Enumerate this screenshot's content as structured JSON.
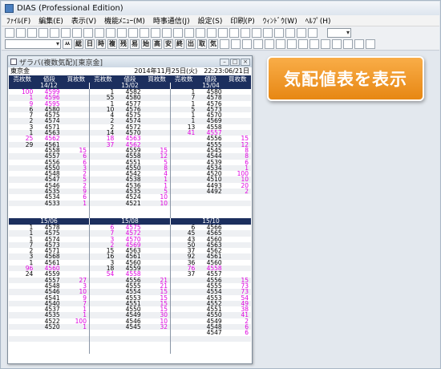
{
  "app": {
    "title": "DIAS (Professional Edition)"
  },
  "menu": [
    "ﾌｧｲﾙ(F)",
    "編集(E)",
    "表示(V)",
    "機能ﾒﾆｭｰ(M)",
    "時事通信(J)",
    "設定(S)",
    "印刷(P)",
    "ｳｨﾝﾄﾞｳ(W)",
    "ﾍﾙﾌﾟ(H)"
  ],
  "toolbar2_kanji": [
    "始",
    "高",
    "安",
    "終",
    "出",
    "取",
    "気"
  ],
  "toolbar2_glyph": [
    "ㅆ",
    "総",
    "日",
    "時",
    "複",
    "残",
    "易"
  ],
  "window": {
    "title": "ザラバ(複数気配)[東京金]",
    "symbol": "東京金",
    "datetime": "2014年11月25日(火)　22:23:06/21日"
  },
  "cols": [
    "売枚数",
    "値段",
    "買枚数"
  ],
  "top_months": [
    "14/12",
    "15/02",
    "15/04"
  ],
  "bottom_months": [
    "15/06",
    "15/08",
    "15/10"
  ],
  "top": [
    [
      [
        "100",
        "4599",
        ""
      ],
      [
        "1",
        "4596",
        ""
      ],
      [
        "9",
        "4595",
        ""
      ],
      [
        "6",
        "4580",
        ""
      ],
      [
        "7",
        "4575",
        ""
      ],
      [
        "2",
        "4574",
        ""
      ],
      [
        "3",
        "4571",
        ""
      ],
      [
        "1",
        "4563",
        ""
      ],
      [
        "25",
        "4562",
        ""
      ],
      [
        "29",
        "4561",
        ""
      ],
      [
        "",
        "4558",
        "15"
      ],
      [
        "",
        "4557",
        "6"
      ],
      [
        "",
        "4556",
        "6"
      ],
      [
        "",
        "4550",
        "3"
      ],
      [
        "",
        "4548",
        "2"
      ],
      [
        "",
        "4547",
        "5"
      ],
      [
        "",
        "4546",
        "2"
      ],
      [
        "",
        "4535",
        "9"
      ],
      [
        "",
        "4534",
        "6"
      ],
      [
        "",
        "4533",
        "1"
      ]
    ],
    [
      [
        "1",
        "4582",
        ""
      ],
      [
        "55",
        "4580",
        ""
      ],
      [
        "1",
        "4577",
        ""
      ],
      [
        "10",
        "4576",
        ""
      ],
      [
        "4",
        "4575",
        ""
      ],
      [
        "2",
        "4574",
        ""
      ],
      [
        "2",
        "4572",
        ""
      ],
      [
        "14",
        "4570",
        ""
      ],
      [
        "18",
        "4563",
        ""
      ],
      [
        "37",
        "4562",
        ""
      ],
      [
        "",
        "4559",
        "15"
      ],
      [
        "",
        "4558",
        "12"
      ],
      [
        "",
        "4551",
        "5"
      ],
      [
        "",
        "4550",
        "8"
      ],
      [
        "",
        "4542",
        "4"
      ],
      [
        "",
        "4538",
        "1"
      ],
      [
        "",
        "4536",
        "1"
      ],
      [
        "",
        "4535",
        "5"
      ],
      [
        "",
        "4524",
        "10"
      ],
      [
        "",
        "4521",
        "10"
      ]
    ],
    [
      [
        "1",
        "4580",
        ""
      ],
      [
        "7",
        "4578",
        ""
      ],
      [
        "1",
        "4576",
        ""
      ],
      [
        "5",
        "4573",
        ""
      ],
      [
        "1",
        "4570",
        ""
      ],
      [
        "1",
        "4569",
        ""
      ],
      [
        "13",
        "4558",
        ""
      ],
      [
        "41",
        "4557",
        ""
      ],
      [
        "",
        "4556",
        "15"
      ],
      [
        "",
        "4555",
        "12"
      ],
      [
        "",
        "4545",
        "8"
      ],
      [
        "",
        "4544",
        "8"
      ],
      [
        "",
        "4539",
        "6"
      ],
      [
        "",
        "4534",
        "1"
      ],
      [
        "",
        "4520",
        "100"
      ],
      [
        "",
        "4510",
        "10"
      ],
      [
        "",
        "4493",
        "20"
      ],
      [
        "",
        "4492",
        "2"
      ],
      [
        "",
        "",
        ""
      ],
      [
        "",
        "",
        ""
      ]
    ]
  ],
  "bottom": [
    [
      [
        "1",
        "4578",
        ""
      ],
      [
        "1",
        "4575",
        ""
      ],
      [
        "1",
        "4574",
        ""
      ],
      [
        "7",
        "4573",
        ""
      ],
      [
        "2",
        "4571",
        ""
      ],
      [
        "3",
        "4568",
        ""
      ],
      [
        "1",
        "4561",
        ""
      ],
      [
        "96",
        "4560",
        ""
      ],
      [
        "24",
        "4559",
        ""
      ],
      [
        "",
        "4557",
        "27"
      ],
      [
        "",
        "4548",
        "3"
      ],
      [
        "",
        "4546",
        "10"
      ],
      [
        "",
        "4541",
        "9"
      ],
      [
        "",
        "4540",
        "7"
      ],
      [
        "",
        "4537",
        "1"
      ],
      [
        "",
        "4535",
        "1"
      ],
      [
        "",
        "4522",
        "100"
      ],
      [
        "",
        "4520",
        "1"
      ],
      [
        "",
        "",
        " "
      ],
      [
        "",
        "",
        ""
      ]
    ],
    [
      [
        "6",
        "4575",
        ""
      ],
      [
        "7",
        "4572",
        ""
      ],
      [
        "3",
        "4570",
        ""
      ],
      [
        "2",
        "4569",
        ""
      ],
      [
        "15",
        "4563",
        ""
      ],
      [
        "16",
        "4561",
        ""
      ],
      [
        "3",
        "4560",
        ""
      ],
      [
        "18",
        "4559",
        ""
      ],
      [
        "54",
        "4558",
        ""
      ],
      [
        "",
        "4556",
        "21"
      ],
      [
        "",
        "4555",
        "21"
      ],
      [
        "",
        "4554",
        "15"
      ],
      [
        "",
        "4553",
        "15"
      ],
      [
        "",
        "4551",
        "15"
      ],
      [
        "",
        "4550",
        "15"
      ],
      [
        "",
        "4549",
        "30"
      ],
      [
        "",
        "4546",
        "10"
      ],
      [
        "",
        "4545",
        "32"
      ],
      [
        "",
        "",
        ""
      ],
      [
        "",
        "",
        ""
      ]
    ],
    [
      [
        "6",
        "4566",
        ""
      ],
      [
        "45",
        "4565",
        ""
      ],
      [
        "43",
        "4560",
        ""
      ],
      [
        "50",
        "4563",
        ""
      ],
      [
        "37",
        "4562",
        ""
      ],
      [
        "92",
        "4561",
        ""
      ],
      [
        "36",
        "4560",
        ""
      ],
      [
        "76",
        "4558",
        ""
      ],
      [
        "37",
        "4557",
        ""
      ],
      [
        "",
        "4556",
        "15"
      ],
      [
        "",
        "4555",
        "73"
      ],
      [
        "",
        "4554",
        "73"
      ],
      [
        "",
        "4553",
        "54"
      ],
      [
        "",
        "4552",
        "49"
      ],
      [
        "",
        "4551",
        "38"
      ],
      [
        "",
        "4550",
        "41"
      ],
      [
        "",
        "4549",
        "2"
      ],
      [
        "",
        "4548",
        "6"
      ],
      [
        "",
        "4547",
        "6"
      ],
      [
        "",
        "",
        ""
      ]
    ]
  ],
  "magenta_sells_top": [
    [
      0,
      1,
      2,
      8
    ],
    [
      8,
      9
    ],
    [
      7
    ]
  ],
  "magenta_sells_bottom": [
    [
      7
    ],
    [
      0,
      1,
      2,
      3,
      8
    ],
    [
      7
    ]
  ],
  "annotation": "気配値表を表示"
}
